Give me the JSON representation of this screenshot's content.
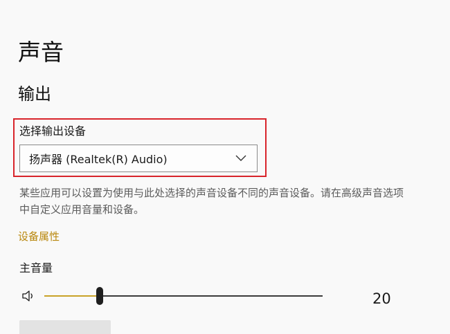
{
  "page": {
    "title": "声音"
  },
  "output": {
    "section_title": "输出",
    "device_label": "选择输出设备",
    "selected_device": "扬声器 (Realtek(R) Audio)",
    "description": "某些应用可以设置为使用与此处选择的声音设备不同的声音设备。请在高级声音选项中自定义应用音量和设备。",
    "device_properties_link": "设备属性",
    "master_volume_label": "主音量",
    "volume_value": "20",
    "volume_level": 20
  },
  "icons": {
    "speaker": "speaker-icon",
    "chevron": "chevron-down-icon"
  },
  "colors": {
    "background": "#f9f9f9",
    "highlight_border": "#d8232a",
    "link": "#b8860b",
    "slider_fill": "#c9a227",
    "slider_track": "#3a3a3a"
  }
}
